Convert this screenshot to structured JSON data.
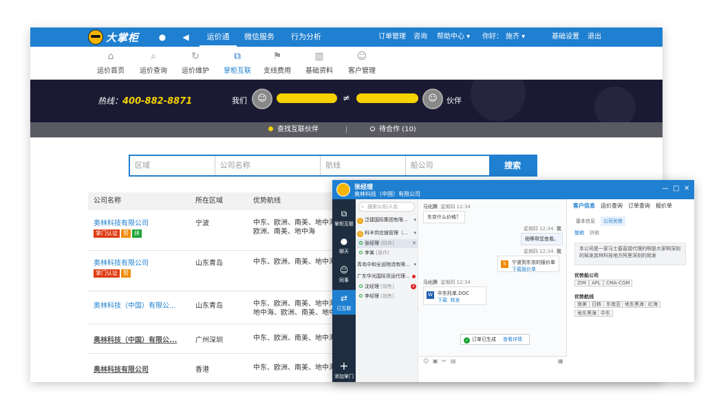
{
  "main": {
    "logo": "大掌柜",
    "nav": [
      "运价通",
      "微信服务",
      "行为分析"
    ],
    "right_nav": {
      "order": "订单管理",
      "consult": "咨询",
      "help": "帮助中心 ▾",
      "greet": "你好：",
      "user": "施齐 ▾",
      "settings": "基础设置",
      "logout": "退出"
    },
    "subnav": [
      "运价首页",
      "运价查询",
      "运价维护",
      "掌柜互联",
      "支线费用",
      "基础资料",
      "客户管理"
    ],
    "banner": {
      "hotline_label": "热线：",
      "hotline": "400-882-8871",
      "us": "我们",
      "neq": "≠",
      "partner": "伙伴"
    },
    "tabs": {
      "find": "查找互联伙伴",
      "sep": "|",
      "pending": "待合作 (10)"
    },
    "search": {
      "region": "区域",
      "company": "公司名称",
      "route": "航线",
      "carrier": "船公司",
      "button": "搜索"
    },
    "table": {
      "headers": [
        "公司名称",
        "所在区域",
        "优势航线"
      ],
      "rows": [
        {
          "name": "奥林科技有限公司",
          "region": "宁波",
          "routes1": "中东、欧洲、南美、地中海",
          "routes2": "欧洲、南美、地中海",
          "badges": [
            "掌门认证",
            "赞",
            "拼"
          ]
        },
        {
          "name": "奥林科技有限公司",
          "region": "山东青岛",
          "routes1": "中东、欧洲、南美、地中海",
          "routes2": "",
          "badges": [
            "掌门认证",
            "赞"
          ]
        },
        {
          "name": "奥林科技（中国）有限公...",
          "region": "山东青岛",
          "routes1": "中东、欧洲、南美、地中海",
          "routes2": "地中海、欧洲、南美、地中海",
          "badges": []
        },
        {
          "name": "奥林科技（中国）有限公...",
          "region": "广州深圳",
          "routes1": "中东、欧洲、南美、地中海",
          "routes2": "",
          "badges": []
        },
        {
          "name": "奥林科技有限公司",
          "region": "香港",
          "routes1": "中东、欧洲、南美、地中海",
          "routes2": "",
          "badges": []
        }
      ]
    }
  },
  "chat": {
    "contact_name": "张经理",
    "contact_org": "奥林科技（中国）有限公司",
    "window_ctrl": [
      "—",
      "□",
      "✕"
    ],
    "sidebar": [
      {
        "label": "掌柜互联",
        "icon": "⧉"
      },
      {
        "label": "聊天",
        "icon": "●"
      },
      {
        "label": "同事",
        "icon": "☺"
      },
      {
        "label": "已互联",
        "icon": "⇄"
      },
      {
        "label": "添加掌门",
        "icon": "+"
      }
    ],
    "search_placeholder": "搜索公司/人名",
    "contacts": [
      {
        "type": "group",
        "text": "泛捷国际集团有限...",
        "trail": "▾"
      },
      {
        "type": "group",
        "text": "科丰供应链管理（...",
        "trail": "▾"
      },
      {
        "type": "person",
        "text": "张经理",
        "role": "[财务]",
        "trail": "✕"
      },
      {
        "type": "person",
        "text": "李某",
        "role": "[操作]",
        "trail": ""
      },
      {
        "type": "plain",
        "text": "青岛中和全运物流有限...",
        "trail": "▾"
      },
      {
        "type": "plain",
        "text": "广东华光国际货运代理...",
        "trail": ""
      },
      {
        "type": "person",
        "text": "沈经理",
        "role": "[销售]",
        "trail": "2"
      },
      {
        "type": "person",
        "text": "李经理",
        "role": "[销售]",
        "trail": ""
      }
    ],
    "messages": {
      "m1_sender": "马化腾",
      "m1_time": "星期四 12:34",
      "m1_text": "东京什么价格？",
      "m2_time": "星期四 12:34",
      "m2_sender": "我",
      "m2_text": "稍等帮您查看。",
      "m3_time": "星期四 12:34",
      "m3_sender": "我",
      "m3_file": "宁波到东京的报价单",
      "m3_link": "下载报价单",
      "m4_sender": "马化腾",
      "m4_time": "星期四 12:34",
      "m4_file": "中东托单.DOC",
      "m4_dl": "下载",
      "m4_fw": "转发",
      "notice": "订单已生成",
      "notice_link": "查看详情"
    },
    "right": {
      "tabs": [
        "客户信息",
        "运价查询",
        "订单查询",
        "报价单"
      ],
      "subtabs": [
        "基本信息",
        "公司优势"
      ],
      "subtabs2": [
        "整箱",
        "拼箱"
      ],
      "intro": "本公司是一家马士基直接代理的啊是大家啊深刻的掉发其林科技地方阿里深刻的就发",
      "carrier_title": "优势船公司",
      "carriers": [
        "ZIM",
        "APL",
        "CMA-CGM"
      ],
      "route_title": "优势航线",
      "routes": [
        "南美",
        "日韩",
        "东南亚",
        "地东黑海",
        "红海",
        "地东黑海",
        "中东"
      ]
    }
  }
}
